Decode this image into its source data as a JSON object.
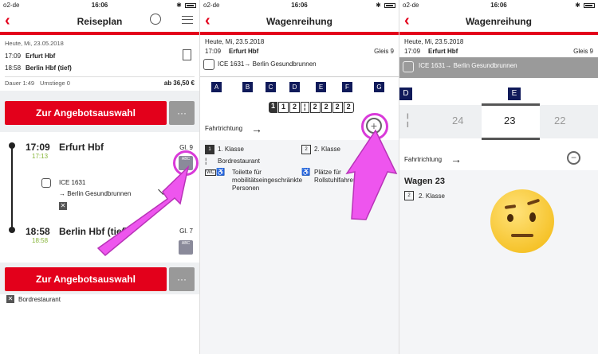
{
  "status_bar": {
    "carrier": "o2-de",
    "time": "16:06"
  },
  "screen1": {
    "title": "Reiseplan",
    "date": "Heute, Mi, 23.05.2018",
    "rows": [
      {
        "time": "17:09",
        "station": "Erfurt Hbf"
      },
      {
        "time": "18:58",
        "station": "Berlin Hbf (tief)"
      }
    ],
    "duration": "Dauer 1:49",
    "changes": "Umstiege 0",
    "price": "ab 36,50 €",
    "offer_button": "Zur Angebotsauswahl",
    "more_button": "···",
    "departure": {
      "time": "17:09",
      "rt": "17:13",
      "station": "Erfurt Hbf",
      "track": "Gl. 9"
    },
    "train": {
      "name": "ICE 1631",
      "dest": "→ Berlin Gesundbrunnen"
    },
    "arrival": {
      "time": "18:58",
      "rt": "18:58",
      "station": "Berlin Hbf (tief)",
      "track": "Gl. 7"
    },
    "offer_button2": "Zur Angebotsauswahl",
    "more_button2": "···",
    "restaurant": "Bordrestaurant"
  },
  "screen2": {
    "title": "Wagenreihung",
    "date": "Heute, Mi, 23.5.2018",
    "time": "17:09",
    "station": "Erfurt Hbf",
    "track": "Gleis 9",
    "train": "ICE 1631→ Berlin Gesundbrunnen",
    "sections": [
      "A",
      "B",
      "C",
      "D",
      "E",
      "F",
      "G"
    ],
    "wagons": [
      "1",
      "1",
      "2",
      "2",
      "2",
      "2",
      "2"
    ],
    "direction": "Fahrtrichtung",
    "legend": {
      "first": "1. Klasse",
      "second": "2. Klasse",
      "restaurant": "Bordrestaurant",
      "toilet": "Toilette für mobilitätseingeschränkte Personen",
      "wheelchair": "Plätze für Rollstuhlfahrer"
    }
  },
  "screen3": {
    "title": "Wagenreihung",
    "date": "Heute, Mi, 23.5.2018",
    "time": "17:09",
    "station": "Erfurt Hbf",
    "track": "Gleis 9",
    "train": "ICE 1631→ Berlin Gesundbrunnen",
    "sections": [
      "D",
      "E"
    ],
    "wagons": [
      "24",
      "23",
      "22"
    ],
    "direction": "Fahrtrichtung",
    "wagon_title": "Wagen 23",
    "class": "2. Klasse"
  }
}
